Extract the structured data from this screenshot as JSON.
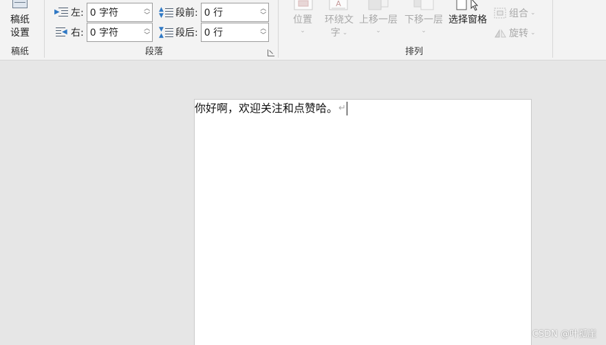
{
  "ribbon": {
    "gaozhi": {
      "button_label_line1": "稿纸",
      "button_label_line2": "设置",
      "group_label": "稿纸"
    },
    "paragraph": {
      "group_label": "段落",
      "indent_left": {
        "label": "左:",
        "value": "0 字符"
      },
      "indent_right": {
        "label": "右:",
        "value": "0 字符"
      },
      "spacing_before": {
        "label": "段前:",
        "value": "0 行"
      },
      "spacing_after": {
        "label": "段后:",
        "value": "0 行"
      }
    },
    "arrange": {
      "group_label": "排列",
      "position": {
        "label": "位置"
      },
      "wrap_text": {
        "label_line1": "环绕文",
        "label_line2": "字"
      },
      "bring_forward": {
        "label": "上移一层"
      },
      "send_backward": {
        "label": "下移一层"
      },
      "selection_pane": {
        "label": "选择窗格"
      },
      "group": {
        "label": "组合"
      },
      "rotate": {
        "label": "旋转"
      }
    }
  },
  "document": {
    "text": "你好啊，欢迎关注和点赞哈。",
    "paragraph_mark": "↵"
  },
  "watermark": "CSDN @叶孤崖",
  "colors": {
    "ribbon_bg": "#f3f3f3",
    "canvas_bg": "#e6e6e6",
    "disabled_text": "#a8a8a8",
    "icon_blue": "#2f78c4"
  }
}
